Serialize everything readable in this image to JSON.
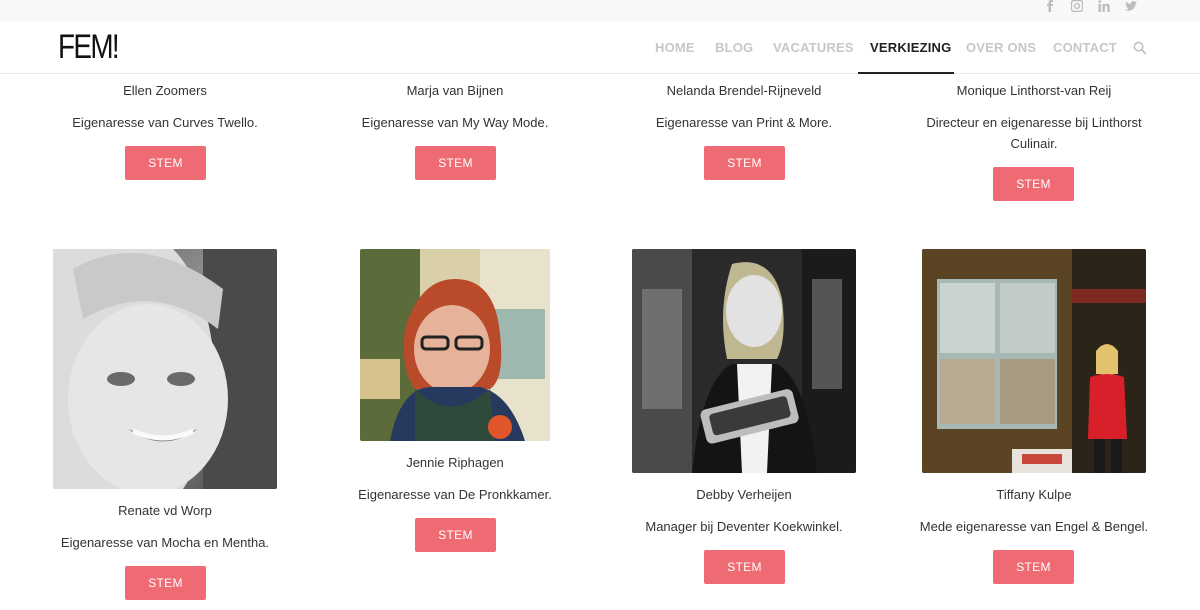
{
  "header": {
    "logo": "FEM!",
    "nav": [
      {
        "label": "HOME",
        "active": false
      },
      {
        "label": "BLOG",
        "active": false
      },
      {
        "label": "VACATURES",
        "active": false
      },
      {
        "label": "VERKIEZING",
        "active": true
      },
      {
        "label": "OVER ONS",
        "active": false
      },
      {
        "label": "CONTACT",
        "active": false
      }
    ],
    "social": [
      "facebook-icon",
      "instagram-icon",
      "linkedin-icon",
      "twitter-icon"
    ]
  },
  "colors": {
    "accent": "#ef6b73",
    "nav_inactive": "#c7c7c7",
    "nav_active": "#222222"
  },
  "row1": [
    {
      "name": "Ellen Zoomers",
      "desc": "Eigenaresse van Curves Twello.",
      "button": "STEM"
    },
    {
      "name": "Marja van Bijnen",
      "desc": "Eigenaresse van My Way Mode.",
      "button": "STEM"
    },
    {
      "name": "Nelanda Brendel-Rijneveld",
      "desc": "Eigenaresse van Print & More.",
      "button": "STEM"
    },
    {
      "name": "Monique Linthorst-van Reij",
      "desc_line1": "Directeur en eigenaresse bij Linthorst",
      "desc_line2": "Culinair.",
      "button": "STEM"
    }
  ],
  "row2": [
    {
      "name": "Renate vd Worp",
      "desc": "Eigenaresse van Mocha en Mentha.",
      "button": "STEM"
    },
    {
      "name": "Jennie Riphagen",
      "desc": "Eigenaresse van De Pronkkamer.",
      "button": "STEM"
    },
    {
      "name": "Debby Verheijen",
      "desc": "Manager bij Deventer Koekwinkel.",
      "button": "STEM"
    },
    {
      "name": "Tiffany Kulpe",
      "desc": "Mede eigenaresse van Engel & Bengel.",
      "button": "STEM"
    }
  ]
}
